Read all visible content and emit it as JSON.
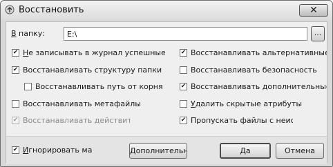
{
  "window": {
    "title": "Восстановить",
    "close_symbol": "✕",
    "icon": "restore-app-icon"
  },
  "folder": {
    "label": "В папку:",
    "value": "E:\\",
    "browse_label": "..."
  },
  "options_left": [
    {
      "label": "Не записывать в журнал успешные во",
      "checked": true,
      "enabled": true
    },
    {
      "label": "Восстанавливать структуру папки",
      "checked": true,
      "enabled": true
    },
    {
      "label": "Восстанавливать путь от корня",
      "checked": false,
      "enabled": true
    },
    {
      "label": "Восстанавливать метафайлы",
      "checked": false,
      "enabled": true
    },
    {
      "label": "Восстанавливать действитель",
      "checked": true,
      "enabled": false
    }
  ],
  "options_right": [
    {
      "label": "Восстанавливать альтернативные поток",
      "checked": true,
      "enabled": true
    },
    {
      "label": "Восстанавливать безопасность",
      "checked": false,
      "enabled": true
    },
    {
      "label": "Восстанавливать дополнительные атриб",
      "checked": true,
      "enabled": true
    },
    {
      "label": "Удалить скрытые атрибуты",
      "checked": false,
      "enabled": true
    },
    {
      "label": "Пропускать файлы с неис",
      "checked": true,
      "enabled": true
    }
  ],
  "ignore_option": {
    "label": "Игнорировать ма",
    "checked": true
  },
  "buttons": {
    "advanced": "Дополнительно >",
    "ok": "Да",
    "cancel": "Отмена"
  }
}
